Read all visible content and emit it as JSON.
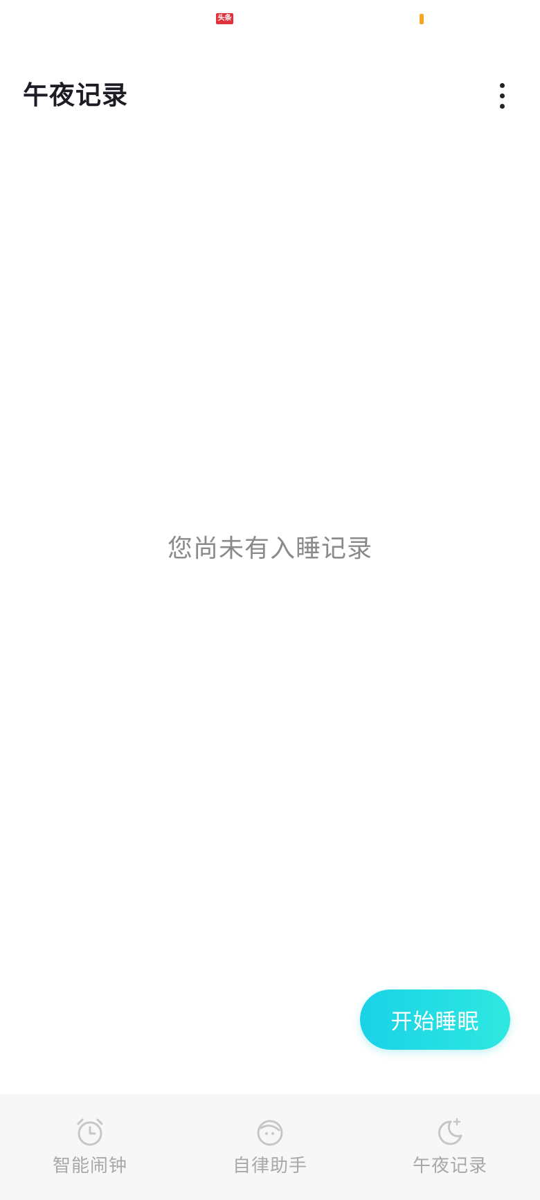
{
  "status_bar": {
    "app_badge": "头条",
    "indicator_color": "#f5a623"
  },
  "header": {
    "title": "午夜记录",
    "more_icon": "more-vertical-icon"
  },
  "main": {
    "empty_message": "您尚未有入睡记录"
  },
  "actions": {
    "start_sleep_label": "开始睡眠",
    "gradient_start": "#1ad2e7",
    "gradient_end": "#2ee8e0"
  },
  "bottom_nav": {
    "items": [
      {
        "label": "智能闹钟",
        "icon": "alarm-clock-icon"
      },
      {
        "label": "自律助手",
        "icon": "face-assistant-icon"
      },
      {
        "label": "午夜记录",
        "icon": "moon-star-icon"
      }
    ],
    "inactive_color": "#a8a8a8"
  }
}
